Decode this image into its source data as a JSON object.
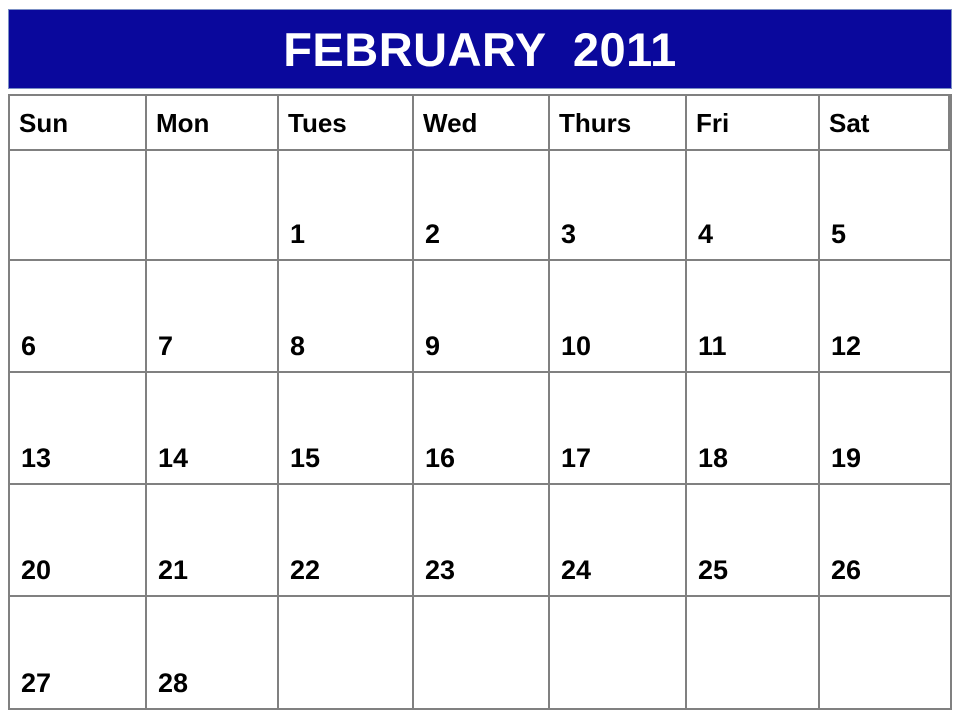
{
  "calendar": {
    "title": "FEBRUARY  2011",
    "month": "FEBRUARY",
    "year": "2011",
    "banner_color": "#0a089c",
    "banner_text_color": "#ffffff",
    "grid_line_color": "#808080",
    "day_text_color": "#000000",
    "day_headers": [
      {
        "label": "Sun"
      },
      {
        "label": "Mon"
      },
      {
        "label": "Tues"
      },
      {
        "label": "Wed"
      },
      {
        "label": "Thurs"
      },
      {
        "label": "Fri"
      },
      {
        "label": "Sat"
      }
    ],
    "weeks": [
      {
        "days": [
          {
            "number": ""
          },
          {
            "number": ""
          },
          {
            "number": "1"
          },
          {
            "number": "2"
          },
          {
            "number": "3"
          },
          {
            "number": "4"
          },
          {
            "number": "5"
          }
        ]
      },
      {
        "days": [
          {
            "number": "6"
          },
          {
            "number": "7"
          },
          {
            "number": "8"
          },
          {
            "number": "9"
          },
          {
            "number": "10"
          },
          {
            "number": "11"
          },
          {
            "number": "12"
          }
        ]
      },
      {
        "days": [
          {
            "number": "13"
          },
          {
            "number": "14"
          },
          {
            "number": "15"
          },
          {
            "number": "16"
          },
          {
            "number": "17"
          },
          {
            "number": "18"
          },
          {
            "number": "19"
          }
        ]
      },
      {
        "days": [
          {
            "number": "20"
          },
          {
            "number": "21"
          },
          {
            "number": "22"
          },
          {
            "number": "23"
          },
          {
            "number": "24"
          },
          {
            "number": "25"
          },
          {
            "number": "26"
          }
        ]
      },
      {
        "days": [
          {
            "number": "27"
          },
          {
            "number": "28"
          },
          {
            "number": ""
          },
          {
            "number": ""
          },
          {
            "number": ""
          },
          {
            "number": ""
          },
          {
            "number": ""
          }
        ]
      }
    ]
  }
}
